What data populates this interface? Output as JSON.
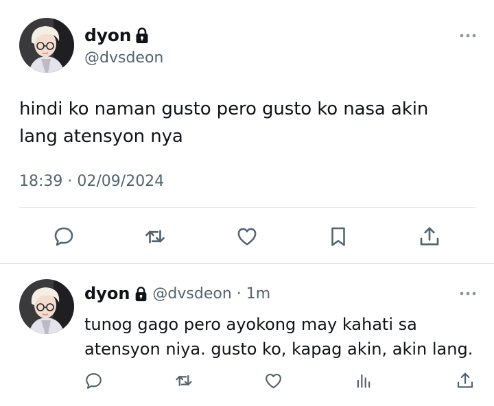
{
  "main_tweet": {
    "display_name": "dyon",
    "handle": "@dvsdeon",
    "text_lines": [
      "hindi ko naman gusto pero gusto ko nasa akin",
      "lang atensyon nya"
    ],
    "timestamp": "18:39 · 02/09/2024",
    "actions": [
      "reply-icon",
      "retweet-icon",
      "like-icon",
      "bookmark-icon",
      "share-icon"
    ]
  },
  "reply": {
    "display_name": "dyon",
    "handle": "@dvsdeon",
    "separator": "·",
    "age": "1m",
    "text_lines": [
      "tunog gago pero ayokong may kahati sa",
      "atensyon niya. gusto ko, kapag akin, akin lang."
    ],
    "actions": [
      "reply-icon",
      "retweet-icon",
      "like-icon",
      "views-icon",
      "share-icon"
    ]
  },
  "colors": {
    "text": "#0f1419",
    "secondary": "#536471",
    "divider": "#e6e9eb"
  }
}
